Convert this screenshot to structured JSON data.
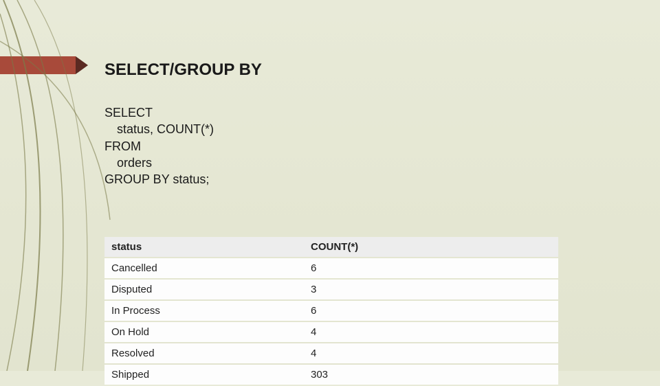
{
  "title": "SELECT/GROUP BY",
  "sql": {
    "line1": "SELECT",
    "line2": "status, COUNT(*)",
    "line3": "FROM",
    "line4": "orders",
    "line5": "GROUP BY status;"
  },
  "chart_data": {
    "type": "table",
    "columns": [
      "status",
      "COUNT(*)"
    ],
    "rows": [
      [
        "Cancelled",
        6
      ],
      [
        "Disputed",
        3
      ],
      [
        "In Process",
        6
      ],
      [
        "On Hold",
        4
      ],
      [
        "Resolved",
        4
      ],
      [
        "Shipped",
        303
      ]
    ]
  }
}
